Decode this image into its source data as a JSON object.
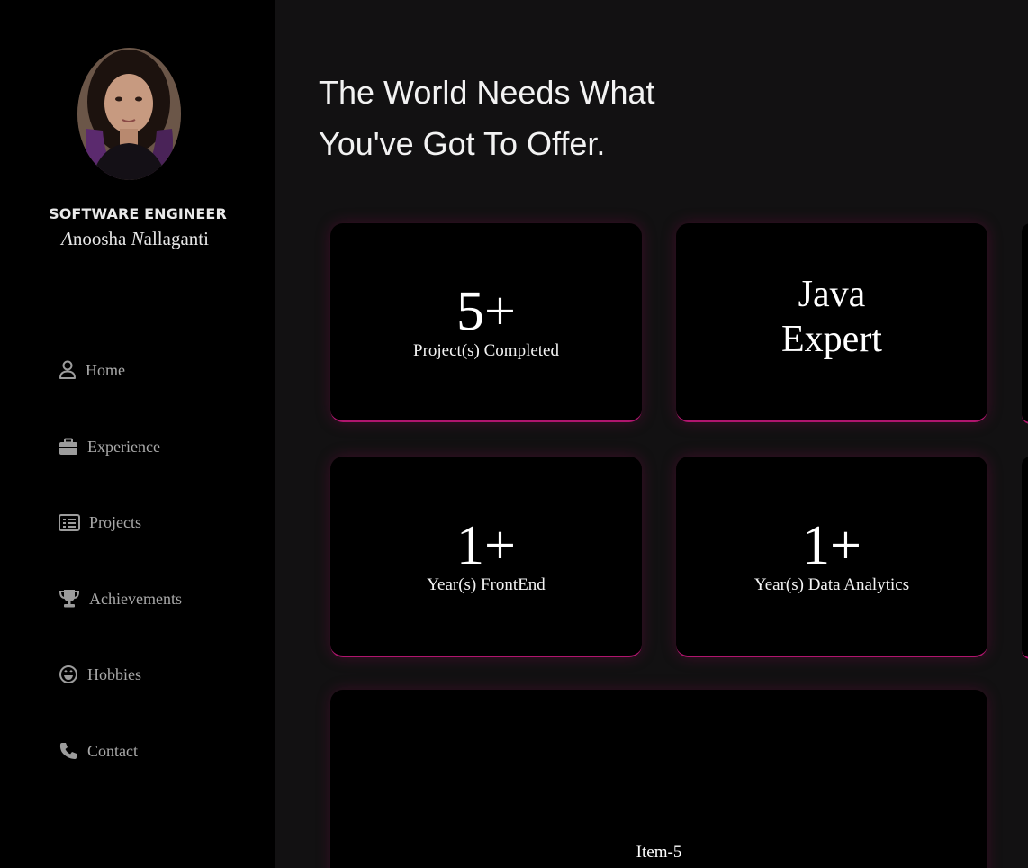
{
  "profile": {
    "role": "SOFTWARE ENGINEER",
    "name_first_initial": "A",
    "name_first_rest": "noosha",
    "name_last_initial": "N",
    "name_last_rest": "allaganti"
  },
  "nav": {
    "items": [
      {
        "label": "Home",
        "icon": "user-icon"
      },
      {
        "label": "Experience",
        "icon": "briefcase-icon"
      },
      {
        "label": "Projects",
        "icon": "list-icon"
      },
      {
        "label": "Achievements",
        "icon": "trophy-icon"
      },
      {
        "label": "Hobbies",
        "icon": "smile-icon"
      },
      {
        "label": "Contact",
        "icon": "phone-icon"
      }
    ]
  },
  "headline": {
    "line1": "The World Needs What",
    "line2": "You've Got To Offer."
  },
  "cards": [
    {
      "value": "5+",
      "label": "Project(s) Completed"
    },
    {
      "line1": "Java",
      "line2": "Expert"
    },
    {
      "value": "1+",
      "label": "Year(s) FrontEnd"
    },
    {
      "value": "1+",
      "label": "Year(s) Data Analytics"
    },
    {
      "label": "Item-5"
    }
  ],
  "colors": {
    "sidebar_bg": "#000000",
    "main_bg": "#121112",
    "card_bg": "#000000",
    "accent": "#b0156e"
  }
}
